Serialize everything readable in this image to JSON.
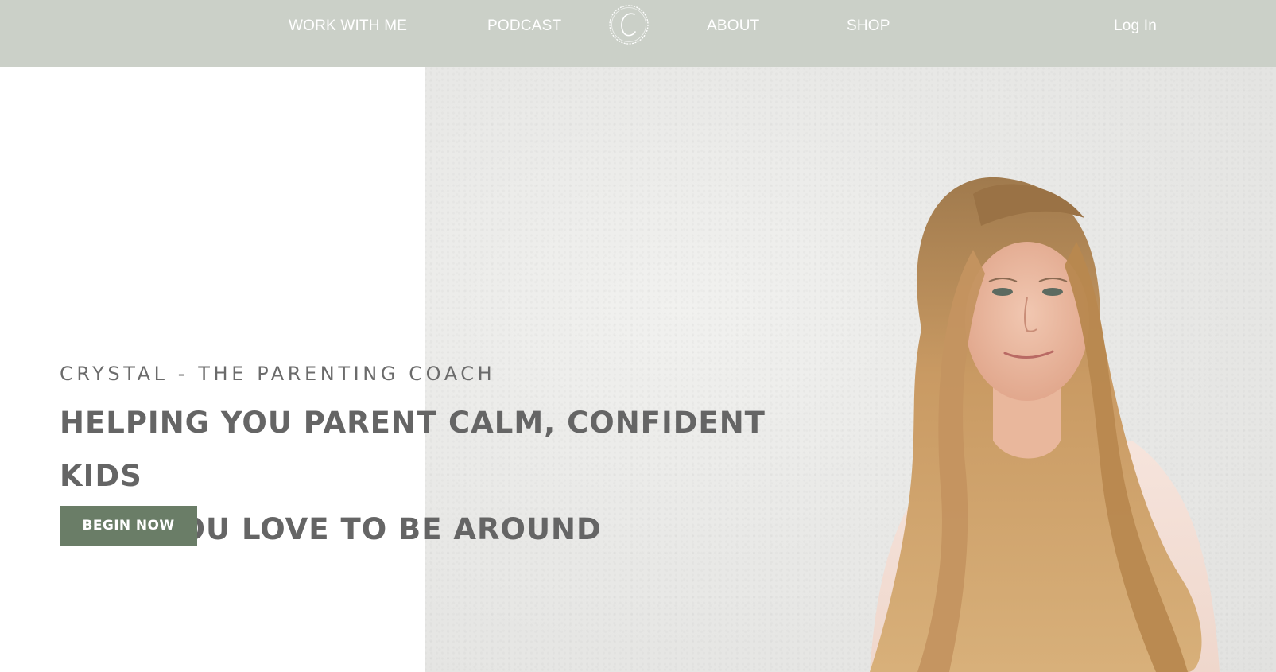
{
  "nav": {
    "items": [
      {
        "label": "WORK WITH ME"
      },
      {
        "label": "PODCAST"
      },
      {
        "label": "ABOUT"
      },
      {
        "label": "SHOP"
      }
    ],
    "login_label": "Log In",
    "logo_icon": "crystal-c-logo-icon"
  },
  "hero": {
    "kicker": "CRYSTAL - THE PARENTING COACH",
    "headline_line1": "HELPING YOU PARENT CALM, CONFIDENT KIDS",
    "headline_line2": "THAT YOU LOVE TO BE AROUND",
    "cta_label": "BEGIN NOW",
    "photo": "woman-with-long-wavy-blonde-hair-smiling-portrait"
  },
  "colors": {
    "nav_bg": "#cbd0c8",
    "cta_bg": "#6a7d67",
    "text_gray": "#656565"
  }
}
